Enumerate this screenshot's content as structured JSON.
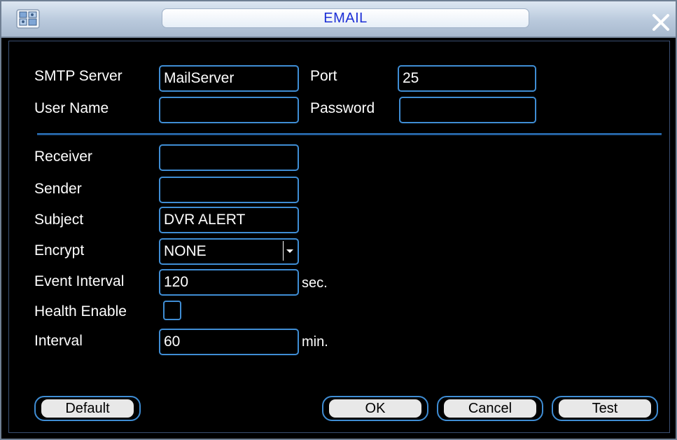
{
  "window": {
    "title": "EMAIL",
    "app_icon": "monitor-icon",
    "close_icon": "close-icon"
  },
  "smtp": {
    "server_label": "SMTP Server",
    "server_value": "MailServer",
    "port_label": "Port",
    "port_value": "25",
    "username_label": "User Name",
    "username_value": "",
    "password_label": "Password",
    "password_value": ""
  },
  "mail": {
    "receiver_label": "Receiver",
    "receiver_value": "",
    "sender_label": "Sender",
    "sender_value": "",
    "subject_label": "Subject",
    "subject_value": "DVR ALERT",
    "encrypt_label": "Encrypt",
    "encrypt_value": "NONE",
    "event_interval_label": "Event Interval",
    "event_interval_value": "120",
    "event_interval_unit": "sec.",
    "health_enable_label": "Health Enable",
    "health_enable_checked": false,
    "interval_label": "Interval",
    "interval_value": "60",
    "interval_unit": "min."
  },
  "buttons": {
    "default": "Default",
    "ok": "OK",
    "cancel": "Cancel",
    "test": "Test"
  },
  "colors": {
    "title_text": "#1c2fd6",
    "field_border": "#3f8dd4",
    "background": "#000000"
  }
}
